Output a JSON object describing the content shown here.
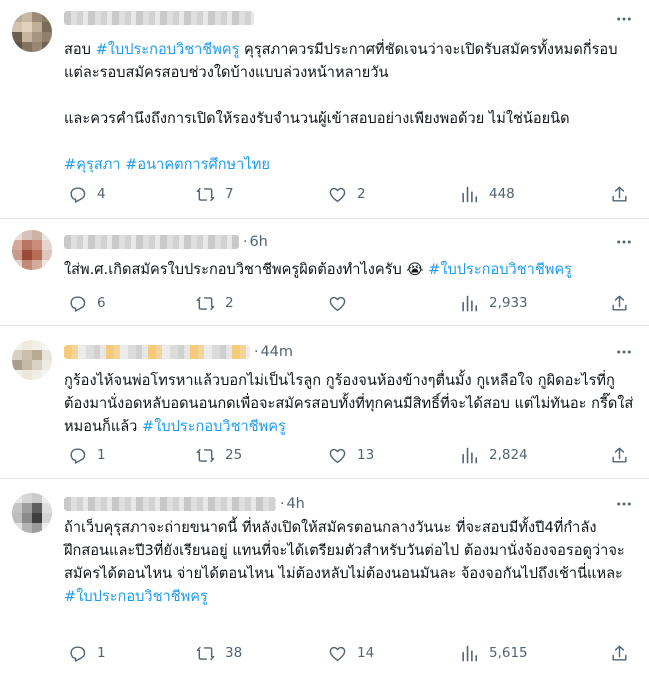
{
  "tweets": [
    {
      "time": "",
      "para1": "สอบ ",
      "para1_tag": "#ใบประกอบวิชาชีพครู",
      "para1_rest": " คุรุสภาควรมีประกาศที่ชัดเจนว่าจะเปิดรับสมัครทั้งหมดกี่รอบ แต่ละรอบสมัครสอบช่วงใดบ้างแบบล่วงหน้าหลายวัน",
      "para2": "และควรคำนึงถึงการเปิดให้รองรับจำนวนผู้เข้าสอบอย่างเพียงพอด้วย ไม่ใช่น้อยนิด",
      "tags_line": "#คุรุสภา #อนาคตการศึกษาไทย",
      "replies": "4",
      "retweets": "7",
      "likes": "2",
      "views": "448"
    },
    {
      "time": "6h",
      "text": "ใส่พ.ศ.เกิดสมัครใบประกอบวิชาชีพครูผิดต้องทำไงครับ ",
      "emoji": "😭",
      "tag": " #ใบประกอบวิชาชีพครู",
      "replies": "6",
      "retweets": "2",
      "likes": "",
      "views": "2,933"
    },
    {
      "time": "44m",
      "text": "กูร้องไห้จนพ่อโทรหาแล้วบอกไม่เป็นไรลูก กูร้องจนห้องข้างๆตื่นมั้ง กูเหลือใจ กูผิดอะไรที่กูต้องมานั่งอดหลับอดนอนกดเพื่อจะสมัครสอบทั้งที่ทุกคนมีสิทธิ์ที่จะได้สอบ แต่ไม่ทันอะ กรี๊ดใส่หมอนก็แล้ว ",
      "tag": "#ใบประกอบวิชาชีพครู",
      "replies": "1",
      "retweets": "25",
      "likes": "13",
      "views": "2,824"
    },
    {
      "time": "4h",
      "text": "ถ้าเว็บคุรุสภาจะถ่ายขนาดนี้ ที่หลังเปิดให้สมัครตอนกลางวันนะ ที่จะสอบมีทั้งปี4ที่กำลังฝึกสอนและปี3ที่ยังเรียนอยู่ แทนที่จะได้เตรียมตัวสำหรับวันต่อไป ต้องมานั่งจ้องจอรอดูว่าจะสมัครได้ตอนไหน จ่ายได้ตอนไหน ไม่ต้องหลับไม่ต้องนอนมันละ จ้องจอกันไปถึงเช้านี่แหละ",
      "tag": "#ใบประกอบวิชาชีพครู",
      "replies": "1",
      "retweets": "38",
      "likes": "14",
      "views": "5,615"
    }
  ],
  "icons": {
    "more": "more-horizontal-icon",
    "reply": "reply-icon",
    "retweet": "retweet-icon",
    "like": "heart-icon",
    "views": "views-chart-icon",
    "share": "share-icon"
  },
  "colors": {
    "hashtag": "#1d9bf0",
    "muted": "#536471",
    "divider": "#e6e9ec"
  }
}
